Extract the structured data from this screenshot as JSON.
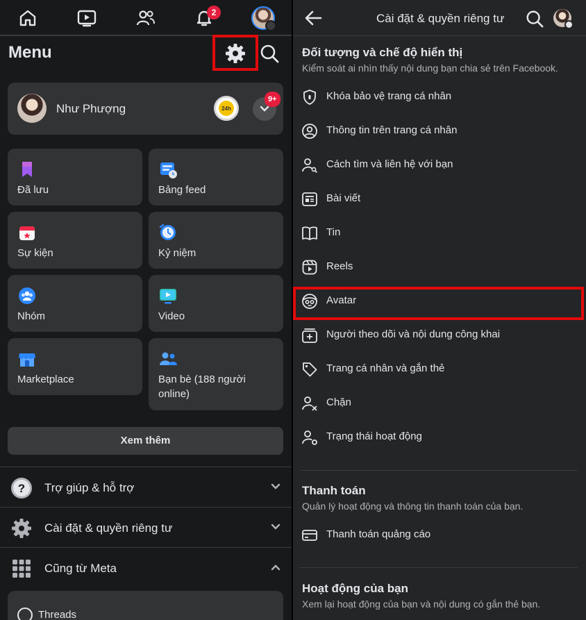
{
  "left": {
    "nav": {
      "notification_count": "2"
    },
    "menu_title": "Menu",
    "profile": {
      "name": "Như Phượng",
      "story_label": "24h",
      "notification_badge": "9+"
    },
    "tiles": [
      {
        "label": "Đã lưu",
        "icon": "bookmark-icon",
        "color": "#a05cf0"
      },
      {
        "label": "Bảng feed",
        "icon": "feed-icon",
        "color": "#2d88ff"
      },
      {
        "label": "Sự kiện",
        "icon": "calendar-icon",
        "color": "#f02849"
      },
      {
        "label": "Kỷ niệm",
        "icon": "clock-icon",
        "color": "#2d88ff"
      },
      {
        "label": "Nhóm",
        "icon": "groups-icon",
        "color": "#2d88ff"
      },
      {
        "label": "Video",
        "icon": "video-icon",
        "color": "#2abba7"
      },
      {
        "label": "Marketplace",
        "icon": "store-icon",
        "color": "#2d88ff"
      },
      {
        "label": "Bạn bè (188 người online)",
        "icon": "friends-icon",
        "color": "#2d88ff"
      }
    ],
    "see_more": "Xem thêm",
    "sections": [
      {
        "label": "Trợ giúp & hỗ trợ",
        "icon": "help-icon"
      },
      {
        "label": "Cài đặt & quyền riêng tư",
        "icon": "settings-gear-icon"
      },
      {
        "label": "Cũng từ Meta",
        "icon": "apps-grid-icon"
      }
    ],
    "threads_label": "Threads"
  },
  "right": {
    "title": "Cài đặt & quyền riêng tư",
    "audience": {
      "title": "Đối tượng và chế độ hiển thị",
      "subtitle": "Kiểm soát ai nhìn thấy nội dung bạn chia sẻ trên Facebook.",
      "items": [
        {
          "label": "Khóa bảo vệ trang cá nhân",
          "icon": "shield-lock-icon"
        },
        {
          "label": "Thông tin trên trang cá nhân",
          "icon": "profile-circle-icon"
        },
        {
          "label": "Cách tìm và liên hệ với bạn",
          "icon": "person-search-icon"
        },
        {
          "label": "Bài viết",
          "icon": "post-icon"
        },
        {
          "label": "Tin",
          "icon": "book-icon"
        },
        {
          "label": "Reels",
          "icon": "reels-icon"
        },
        {
          "label": "Avatar",
          "icon": "avatar-icon"
        },
        {
          "label": "Người theo dõi và nội dung công khai",
          "icon": "followers-icon"
        },
        {
          "label": "Trang cá nhân và gắn thẻ",
          "icon": "tag-icon"
        },
        {
          "label": "Chặn",
          "icon": "block-person-icon"
        },
        {
          "label": "Trạng thái hoạt động",
          "icon": "active-status-icon"
        }
      ]
    },
    "payments": {
      "title": "Thanh toán",
      "subtitle": "Quản lý hoạt động và thông tin thanh toán của bạn.",
      "items": [
        {
          "label": "Thanh toán quảng cáo",
          "icon": "credit-card-icon"
        }
      ]
    },
    "activity": {
      "title": "Hoạt động của bạn",
      "subtitle": "Xem lại hoạt động của bạn và nội dung có gắn thẻ bạn."
    }
  },
  "colors": {
    "highlight_box": "#e00b0b",
    "badge": "#e41e3f",
    "accent": "#2d88ff"
  }
}
